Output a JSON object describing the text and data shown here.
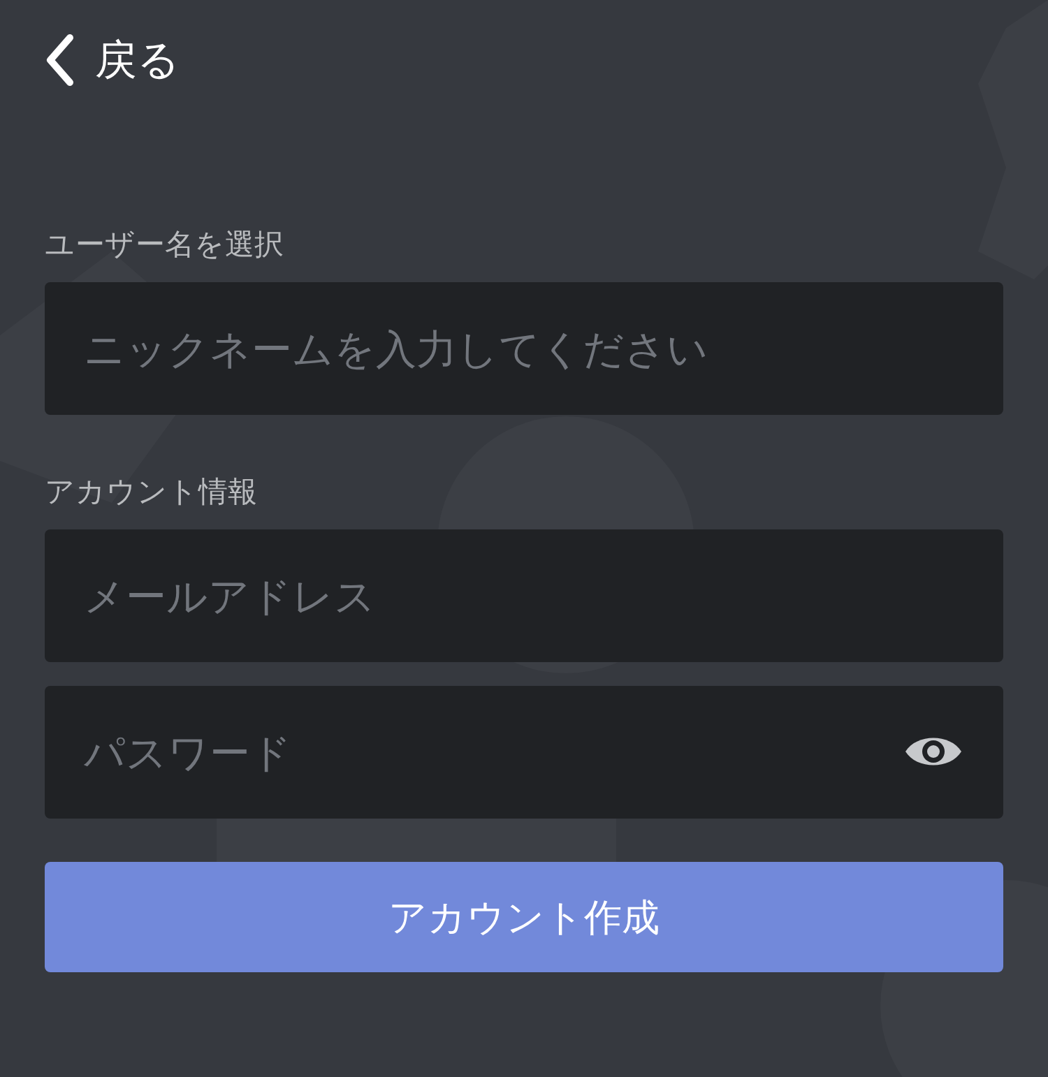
{
  "back": {
    "label": "戻る"
  },
  "sections": [
    {
      "label": "ユーザー名を選択",
      "fields": [
        {
          "kind": "text",
          "placeholder": "ニックネームを入力してください"
        }
      ]
    },
    {
      "label": "アカウント情報",
      "fields": [
        {
          "kind": "text",
          "placeholder": "メールアドレス"
        },
        {
          "kind": "password",
          "placeholder": "パスワード"
        }
      ]
    }
  ],
  "submit": {
    "label": "アカウント作成"
  }
}
